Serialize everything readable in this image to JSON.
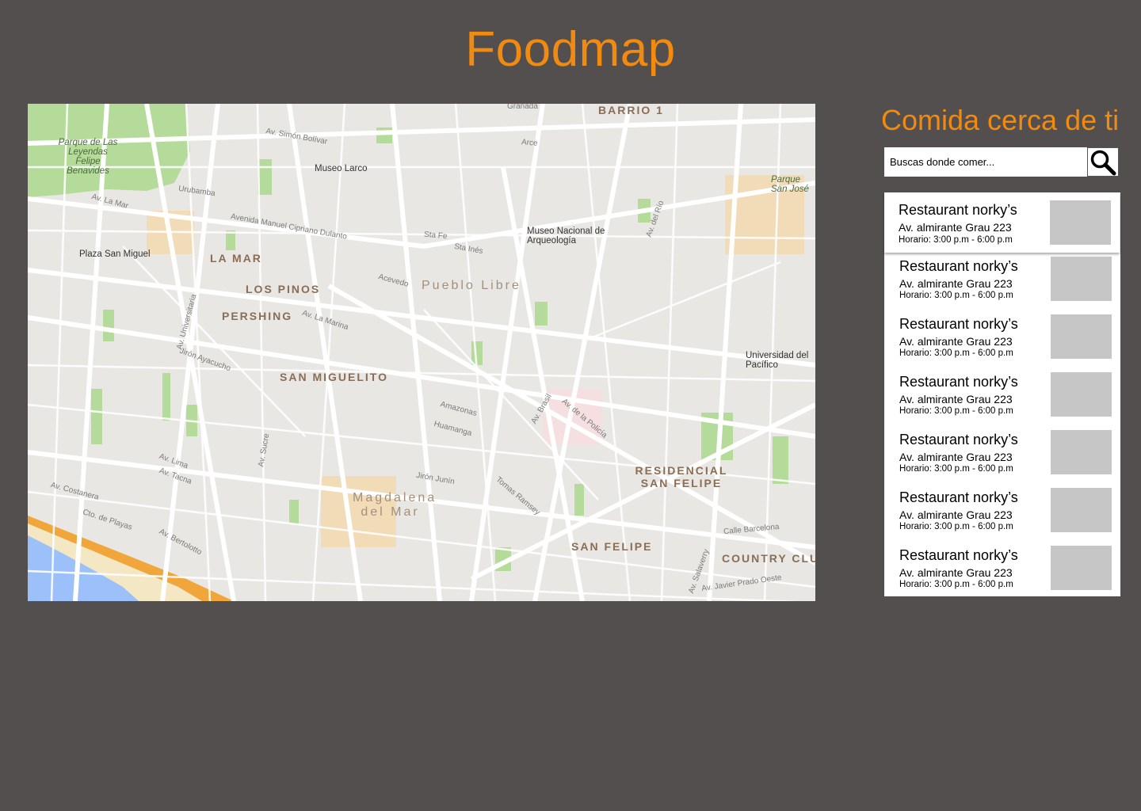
{
  "app": {
    "title": "Foodmap"
  },
  "sidebar": {
    "title": "Comida cerca de ti",
    "search": {
      "placeholder": "Buscas donde comer...",
      "value": ""
    },
    "restaurants": [
      {
        "name": "Restaurant norky’s",
        "address": "Av. almirante Grau 223",
        "hours": "Horario: 3:00 p.m - 6:00 p.m"
      },
      {
        "name": "Restaurant norky’s",
        "address": "Av. almirante Grau 223",
        "hours": "Horario: 3:00 p.m - 6:00 p.m"
      },
      {
        "name": "Restaurant norky’s",
        "address": "Av. almirante Grau 223",
        "hours": "Horario: 3:00 p.m - 6:00 p.m"
      },
      {
        "name": "Restaurant norky’s",
        "address": "Av. almirante Grau 223",
        "hours": "Horario: 3:00 p.m - 6:00 p.m"
      },
      {
        "name": "Restaurant norky’s",
        "address": "Av. almirante Grau 223",
        "hours": "Horario: 3:00 p.m - 6:00 p.m"
      },
      {
        "name": "Restaurant norky’s",
        "address": "Av. almirante Grau 223",
        "hours": "Horario: 3:00 p.m - 6:00 p.m"
      },
      {
        "name": "Restaurant norky’s",
        "address": "Av. almirante Grau 223",
        "hours": "Horario: 3:00 p.m - 6:00 p.m"
      }
    ]
  },
  "map": {
    "districts": [
      "BARRIO 1",
      "LA MAR",
      "LOS PINOS",
      "Pueblo Libre",
      "PERSHING",
      "SAN MIGUELITO",
      "Magdalena del Mar",
      "RESIDENCIAL SAN FELIPE",
      "SAN FELIPE",
      "COUNTRY CLU"
    ],
    "pois": [
      "Parque de Las Leyendas Felipe Benavides",
      "Museo Larco",
      "Plaza San Miguel",
      "Museo Nacional de Arqueología",
      "Universidad del Pacífico",
      "Parque San José"
    ],
    "streets": [
      "Av. Simón Bolívar",
      "Avenida Manuel Cipriano Dulanto",
      "Av. La Mar",
      "Av. La Marina",
      "Av. Universitaria",
      "Av. Brasil",
      "Av. Costanera",
      "Cto. de Playas",
      "Av. del Río",
      "Av. Javier Prado Oeste",
      "Av. Sucre",
      "Jirón Ayacucho",
      "Av. Lima",
      "Av. Tacna",
      "Amazonas",
      "Huamanga",
      "Jirón Junín",
      "Acevedo",
      "Sta Fe",
      "Sta Inés",
      "Urubamba",
      "Arce",
      "Granada",
      "Av. de la Policía",
      "Av. Salaverry",
      "Calle Barcelona",
      "Tomas Ramsey",
      "Av. Bertolotto"
    ],
    "colors": {
      "land": "#e9e7e3",
      "road": "#ffffff",
      "park": "#b5db9a",
      "urban": "#f2dcb8",
      "water": "#9cc0f9",
      "coast": "#f0a63a"
    }
  }
}
